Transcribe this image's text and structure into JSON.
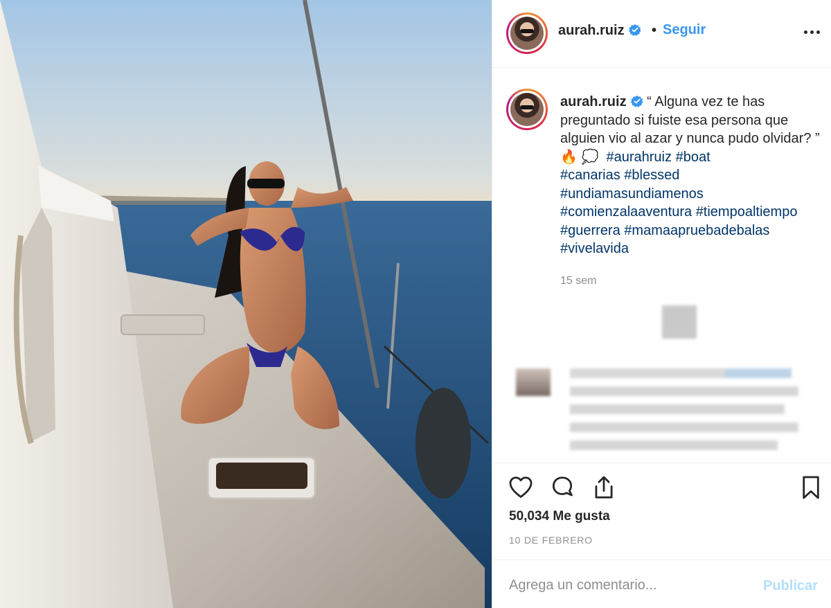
{
  "post": {
    "image_alt": "woman kneeling on sailboat deck at sunset",
    "author": {
      "username": "aurah.ruiz",
      "verified": true
    },
    "header": {
      "separator": "•",
      "follow_label": "Seguir"
    },
    "caption": {
      "text": "“ Alguna vez te has preguntado si fuiste esa persona que alguien vio al azar y nunca pudo olvidar? ” 🔥 💭",
      "hashtags": [
        "#aurahruiz",
        "#boat",
        "#canarias",
        "#blessed",
        "#undiamasundiamenos",
        "#comienzalaaventura",
        "#tiempoaltiempo",
        "#guerrera",
        "#mamaapruebadebalas",
        "#vivelavida"
      ]
    },
    "relative_time": "15 sem",
    "likes_text": "50,034 Me gusta",
    "date_text": "10 DE FEBRERO",
    "comment": {
      "placeholder": "Agrega un comentario...",
      "publish_label": "Publicar"
    },
    "icons": {
      "like": "heart-icon",
      "comment": "comment-icon",
      "share": "share-icon",
      "save": "bookmark-icon",
      "more": "more-options-icon",
      "verified": "verified-badge-icon"
    },
    "colors": {
      "link": "#3897f0",
      "hashtag": "#003569",
      "muted": "#8e8e8e",
      "publish_disabled": "#b2dffc"
    }
  }
}
